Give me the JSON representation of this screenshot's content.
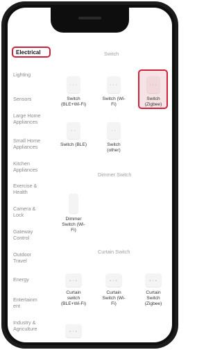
{
  "sidebar": {
    "items": [
      {
        "label": "Electrical",
        "active": true
      },
      {
        "label": "Lighting"
      },
      {
        "label": "Sensors"
      },
      {
        "label": "Large Home Appliances"
      },
      {
        "label": "Small Home Appliances"
      },
      {
        "label": "Kitchen Appliances"
      },
      {
        "label": "Exercise & Health"
      },
      {
        "label": "Camera & Lock"
      },
      {
        "label": "Gateway Control"
      },
      {
        "label": "Outdoor Travel"
      },
      {
        "label": "Energy"
      },
      {
        "label": "Entertainm ent"
      },
      {
        "label": "Industry & Agriculture"
      }
    ]
  },
  "sections": {
    "switch": {
      "title": "Switch",
      "devices": [
        {
          "label": "Switch (BLE+Wi-Fi)"
        },
        {
          "label": "Switch (Wi-Fi)"
        },
        {
          "label": "Switch (Zigbee)",
          "selected": true
        },
        {
          "label": "Switch (BLE)"
        },
        {
          "label": "Switch (other)"
        }
      ]
    },
    "dimmer_switch": {
      "title": "Dimmer Switch",
      "devices": [
        {
          "label": "Dimmer Switch (Wi-Fi)"
        }
      ]
    },
    "curtain_switch": {
      "title": "Curtain Switch",
      "devices": [
        {
          "label": "Curtain switch (BLE+Wi-Fi)"
        },
        {
          "label": "Curtain Switch (Wi-Fi)"
        },
        {
          "label": "Curtain Switch (Zigbee)"
        }
      ]
    }
  },
  "colors": {
    "highlight": "#d0223a",
    "frame": "#1b1b1b"
  }
}
